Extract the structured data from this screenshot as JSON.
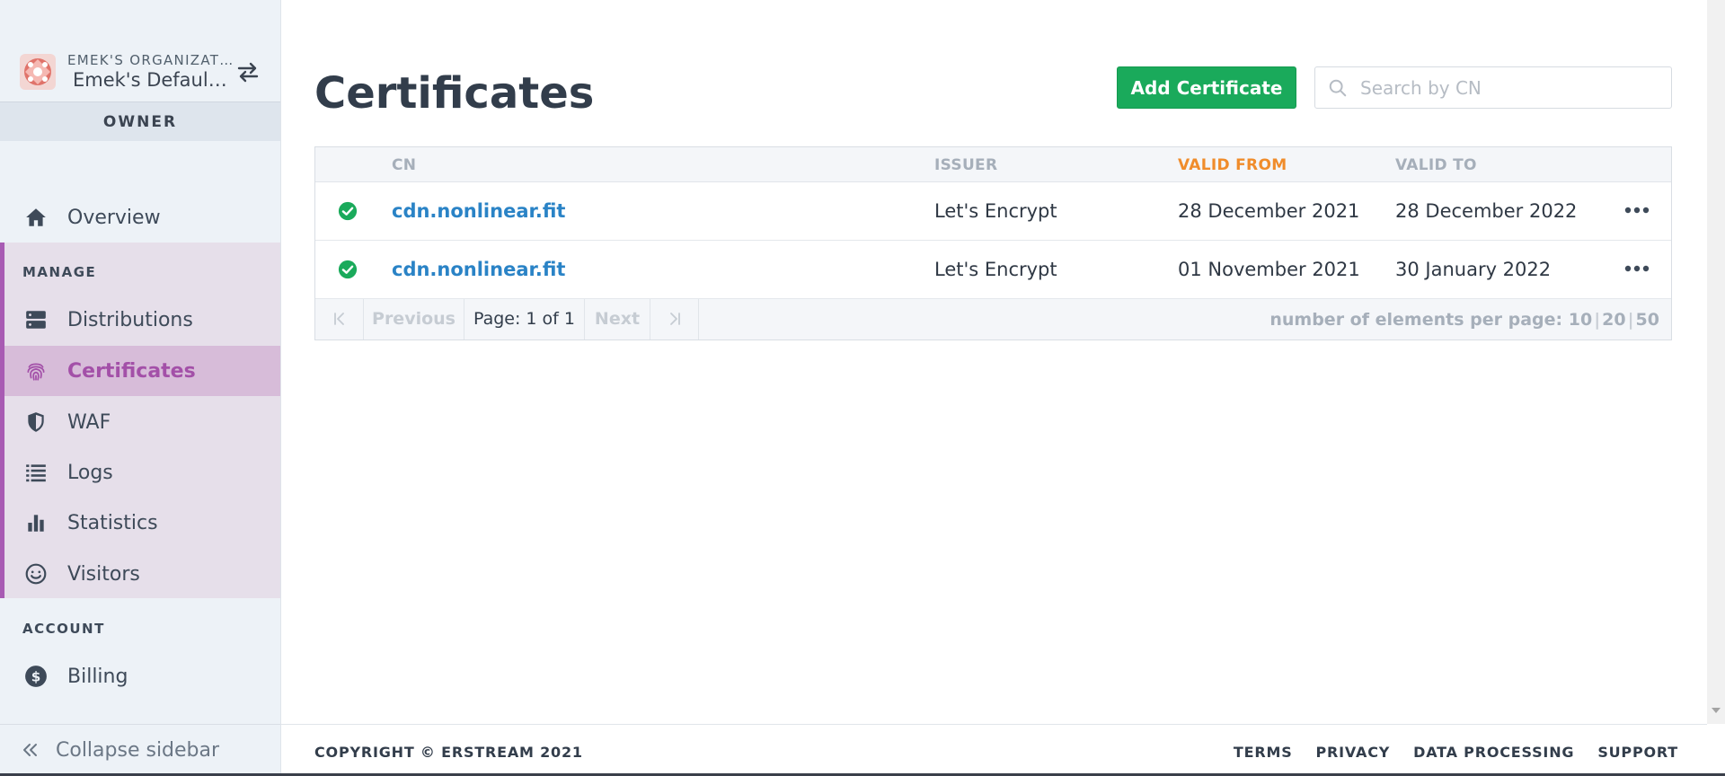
{
  "org": {
    "label": "EMEK'S ORGANIZATION",
    "name": "Emek's Default Project",
    "role": "OWNER"
  },
  "nav": {
    "overview": "Overview",
    "manage_title": "MANAGE",
    "items": [
      {
        "label": "Distributions",
        "icon": "server-icon"
      },
      {
        "label": "Certificates",
        "icon": "fingerprint-icon",
        "active": true
      },
      {
        "label": "WAF",
        "icon": "shield-icon"
      },
      {
        "label": "Logs",
        "icon": "list-icon"
      },
      {
        "label": "Statistics",
        "icon": "bar-chart-icon"
      },
      {
        "label": "Visitors",
        "icon": "smiley-icon"
      }
    ],
    "account_title": "ACCOUNT",
    "billing": "Billing",
    "collapse": "Collapse sidebar"
  },
  "page": {
    "title": "Certificates",
    "add_button": "Add Certificate",
    "search_placeholder": "Search by CN"
  },
  "table": {
    "columns": [
      "CN",
      "ISSUER",
      "VALID FROM",
      "VALID TO"
    ],
    "sorted_column": "VALID FROM",
    "rows": [
      {
        "cn": "cdn.nonlinear.fit",
        "issuer": "Let's Encrypt",
        "valid_from": "28 December 2021",
        "valid_to": "28 December 2022"
      },
      {
        "cn": "cdn.nonlinear.fit",
        "issuer": "Let's Encrypt",
        "valid_from": "01 November 2021",
        "valid_to": "30 January 2022"
      }
    ]
  },
  "pager": {
    "previous": "Previous",
    "page_info": "Page: 1 of 1",
    "next": "Next",
    "per_page_label": "number of elements per page:",
    "per_page_options": [
      "10",
      "20",
      "50"
    ]
  },
  "footer": {
    "copyright": "COPYRIGHT © ERSTREAM 2021",
    "links": [
      "TERMS",
      "PRIVACY",
      "DATA PROCESSING",
      "SUPPORT"
    ]
  },
  "colors": {
    "accent_purple": "#a350a8",
    "primary_green": "#1aaa5b",
    "link_blue": "#2a83c6",
    "sort_orange": "#f08c2b"
  }
}
